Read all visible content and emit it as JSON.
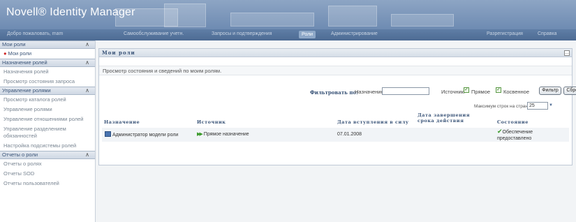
{
  "app": {
    "title": "Novell® Identity Manager",
    "welcome": "Добро пожаловать, mam",
    "tabs": [
      "Самообслуживание учетн.",
      "Запросы и подтверждения",
      "Роли",
      "Администрирование"
    ],
    "active_tab": "Роли",
    "links": [
      "Разрегистрация",
      "Справка"
    ]
  },
  "sidebar": {
    "sections": [
      {
        "title": "Мои роли",
        "items": [
          "Мои роли"
        ],
        "active": "Мои роли"
      },
      {
        "title": "Назначение ролей",
        "items": [
          "Назначения ролей",
          "Просмотр состояния запроса"
        ]
      },
      {
        "title": "Управление ролями",
        "items": [
          "Просмотр каталога ролей",
          "Управление ролями",
          "Управление отношениями ролей",
          "Управление разделением обязанностей",
          "Настройка подсистемы ролей"
        ]
      },
      {
        "title": "Отчеты о роли",
        "items": [
          "Отчеты о ролях",
          "Отчеты SOD",
          "Отчеты пользователей"
        ]
      }
    ]
  },
  "main": {
    "title": "Мои роли",
    "description": "Просмотр состояния и сведений по моим ролям.",
    "filter": {
      "label": "Фильтровать по:",
      "destination_label": "Назначение",
      "destination_value": "",
      "source_label": "Источник:",
      "direct_label": "Прямое",
      "direct_checked": true,
      "indirect_label": "Косвенное",
      "indirect_checked": true,
      "filter_button": "Фильтр",
      "reset_button": "Сброс"
    },
    "max_rows_label": "Максимум строк на странице",
    "max_rows_value": "25",
    "table": {
      "columns": [
        "Назначение",
        "Источник",
        "Дата вступления в силу",
        "Дата завершения срока действия",
        "Состояние"
      ],
      "rows": [
        {
          "assignment": "Администратор модели роли",
          "source": "Прямое назначение",
          "effective_date": "07.01.2008",
          "expiration_date": "",
          "status": "Обеспечение предоставлено"
        }
      ]
    }
  },
  "colors": {
    "banner": "#7a95b8",
    "navbar": "#56749c",
    "accent": "#3a5478",
    "check_green": "#3a9a2a"
  }
}
